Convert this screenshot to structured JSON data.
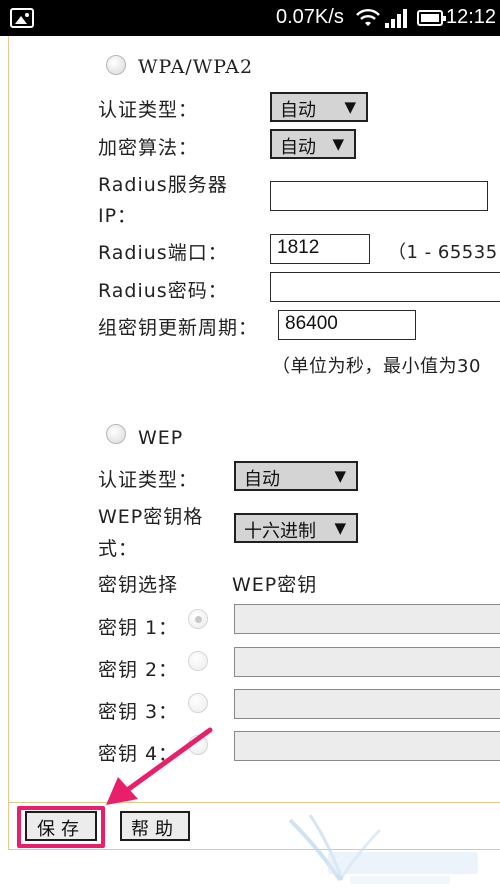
{
  "status_bar": {
    "net_speed": "0.07K/s",
    "time": "12:12",
    "icons": [
      "gallery-icon",
      "wifi-icon",
      "signal-icon",
      "battery-icon"
    ]
  },
  "wpa": {
    "title": "WPA/WPA2",
    "auth_label": "认证类型：",
    "auth_value": "自动",
    "encrypt_label": "加密算法：",
    "encrypt_value": "自动",
    "radius_server_label_1": "Radius服务器",
    "radius_server_label_2": "IP：",
    "radius_server_value": "",
    "radius_port_label": "Radius端口：",
    "radius_port_value": "1812",
    "radius_port_hint": "（1 - 65535",
    "radius_pwd_label": "Radius密码：",
    "radius_pwd_value": "",
    "group_key_label": "组密钥更新周期：",
    "group_key_value": "86400",
    "group_key_hint": "（单位为秒，最小值为30"
  },
  "wep": {
    "title": "WEP",
    "auth_label": "认证类型：",
    "auth_value": "自动",
    "format_label_1": "WEP密钥格",
    "format_label_2": "式：",
    "format_value": "十六进制",
    "key_select_header": "密钥选择",
    "key_header": "WEP密钥",
    "keys": [
      {
        "label": "密钥 1：",
        "value": ""
      },
      {
        "label": "密钥 2：",
        "value": ""
      },
      {
        "label": "密钥 3：",
        "value": ""
      },
      {
        "label": "密钥 4：",
        "value": ""
      }
    ]
  },
  "buttons": {
    "save": "保存",
    "help": "帮助"
  },
  "colors": {
    "highlight": "#e91f6b",
    "frame_border": "#e8c889"
  }
}
